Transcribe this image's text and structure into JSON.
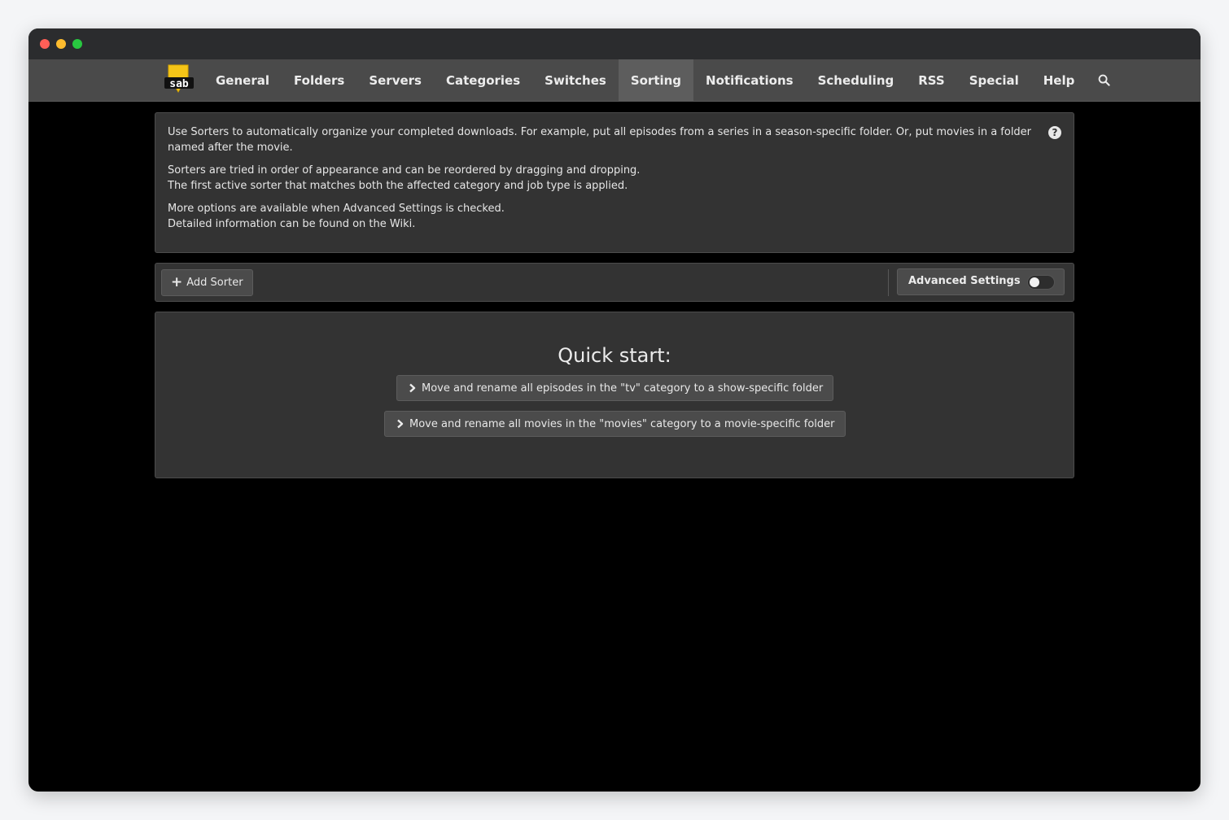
{
  "nav": {
    "items": [
      {
        "label": "General",
        "active": false
      },
      {
        "label": "Folders",
        "active": false
      },
      {
        "label": "Servers",
        "active": false
      },
      {
        "label": "Categories",
        "active": false
      },
      {
        "label": "Switches",
        "active": false
      },
      {
        "label": "Sorting",
        "active": true
      },
      {
        "label": "Notifications",
        "active": false
      },
      {
        "label": "Scheduling",
        "active": false
      },
      {
        "label": "RSS",
        "active": false
      },
      {
        "label": "Special",
        "active": false
      },
      {
        "label": "Help",
        "active": false
      }
    ],
    "search_icon": "search-icon",
    "logo_text": "sab"
  },
  "info": {
    "p1": "Use Sorters to automatically organize your completed downloads. For example, put all episodes from a series in a season-specific folder. Or, put movies in a folder named after the movie.",
    "p2_line1": "Sorters are tried in order of appearance and can be reordered by dragging and dropping.",
    "p2_line2": "The first active sorter that matches both the affected category and job type is applied.",
    "p3_line1": "More options are available when Advanced Settings is checked.",
    "p3_line2": "Detailed information can be found on the Wiki.",
    "help_glyph": "?"
  },
  "toolbar": {
    "add_sorter_label": "Add Sorter",
    "plus_glyph": "+",
    "advanced_settings_label": "Advanced Settings",
    "advanced_settings_enabled": false
  },
  "quick_start": {
    "title": "Quick start:",
    "chevron_glyph": "›",
    "tv_button_label": "Move and rename all episodes in the \"tv\" category to a show-specific folder",
    "movies_button_label": "Move and rename all movies in the \"movies\" category to a movie-specific folder"
  },
  "colors": {
    "logo_yellow": "#f5c518",
    "navbar": "#4a4a4a",
    "panel": "#333333",
    "background": "#000000"
  }
}
